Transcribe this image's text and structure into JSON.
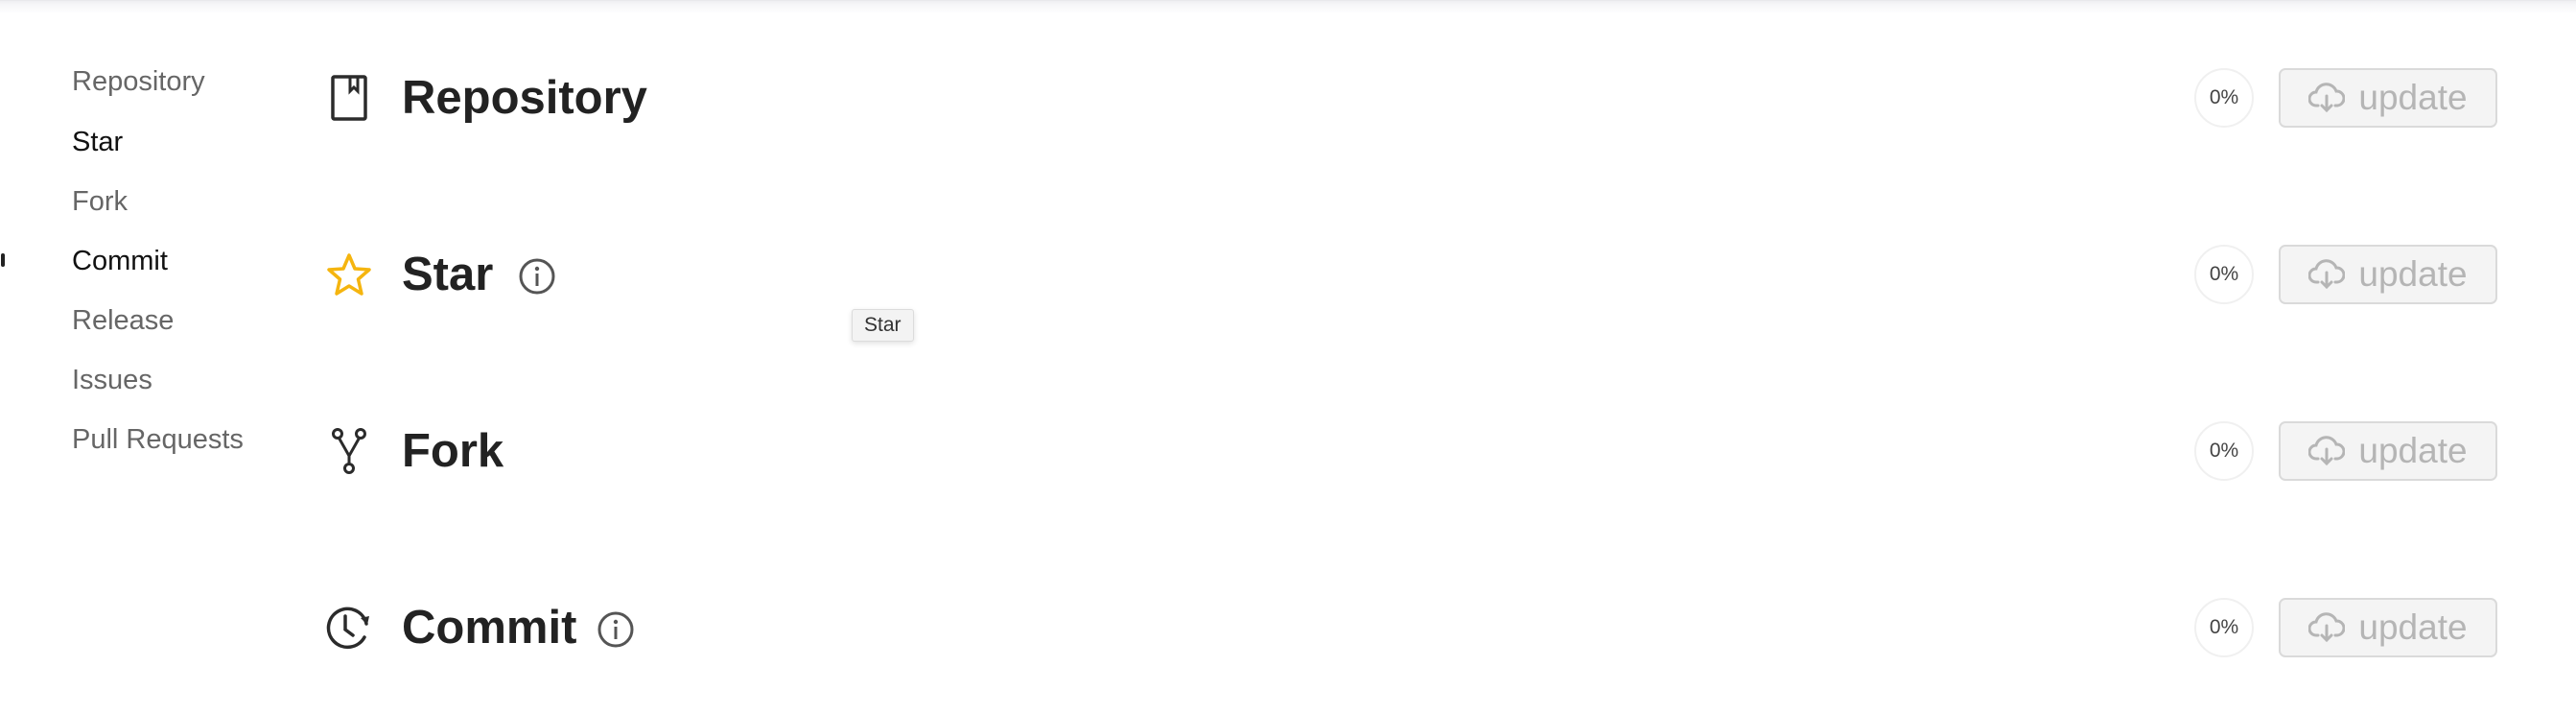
{
  "sidebar": {
    "items": [
      {
        "label": "Repository",
        "active": false
      },
      {
        "label": "Star",
        "active": true
      },
      {
        "label": "Fork",
        "active": false
      },
      {
        "label": "Commit",
        "active": true
      },
      {
        "label": "Release",
        "active": false
      },
      {
        "label": "Issues",
        "active": false
      },
      {
        "label": "Pull Requests",
        "active": false
      }
    ]
  },
  "sections": [
    {
      "title": "Repository",
      "icon": "repo-book-icon",
      "has_info": false,
      "progress": "0%",
      "button_label": "update"
    },
    {
      "title": "Star",
      "icon": "star-icon",
      "has_info": true,
      "progress": "0%",
      "button_label": "update"
    },
    {
      "title": "Fork",
      "icon": "fork-icon",
      "has_info": false,
      "progress": "0%",
      "button_label": "update"
    },
    {
      "title": "Commit",
      "icon": "history-icon",
      "has_info": true,
      "progress": "0%",
      "button_label": "update"
    }
  ],
  "tooltip": {
    "text": "Star"
  },
  "colors": {
    "star_accent": "#F5B50F",
    "text_dark": "#222222",
    "nav_inactive": "#666666",
    "button_disabled_text": "#B5B5B5"
  }
}
